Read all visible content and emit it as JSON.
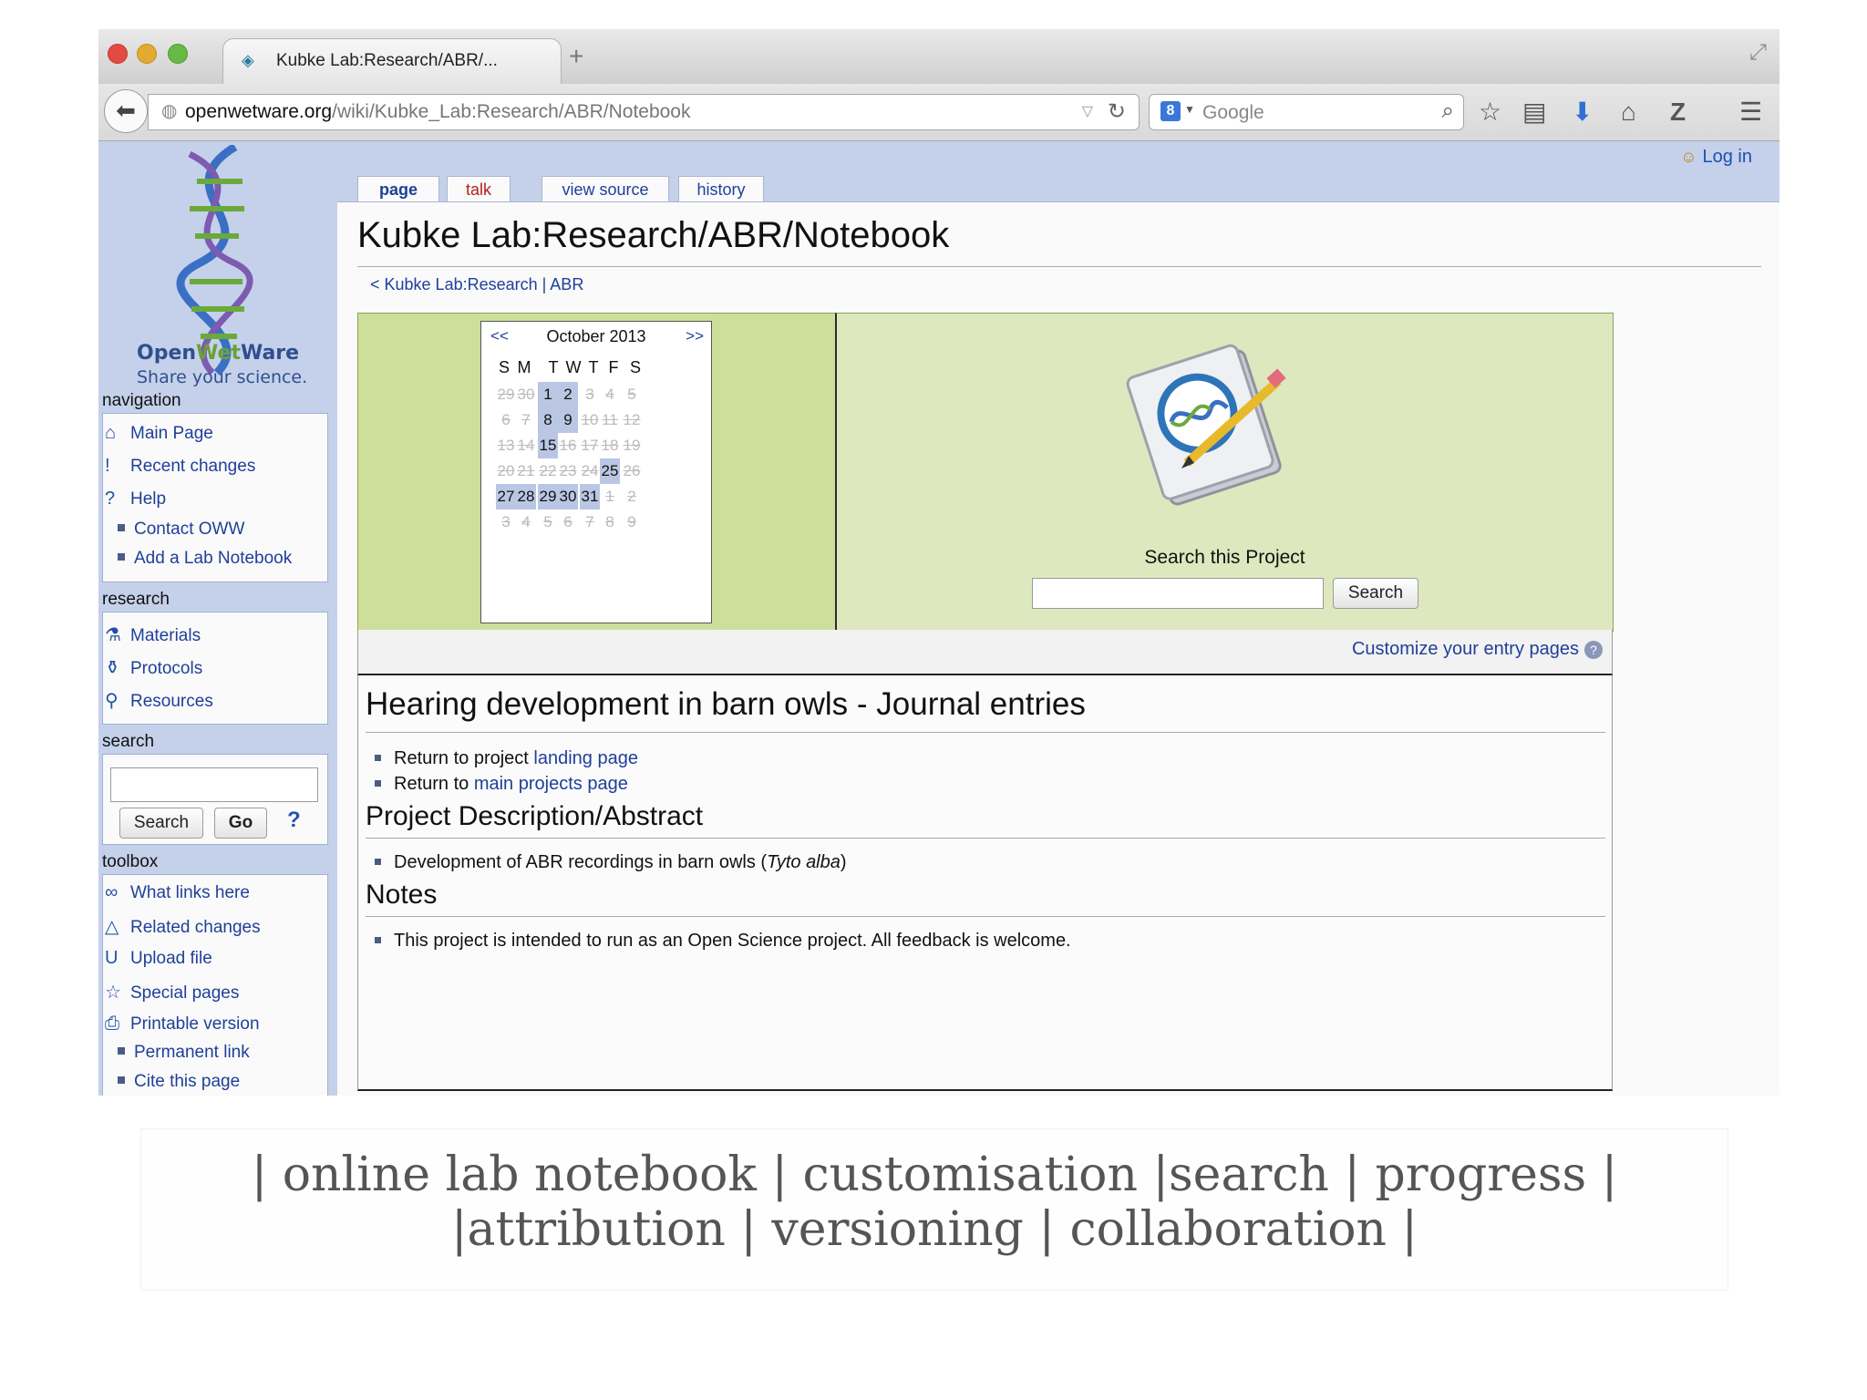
{
  "browser": {
    "tab_title": "Kubke Lab:Research/ABR/...",
    "new_tab": "+",
    "url_host": "openwetware.org",
    "url_path": "/wiki/Kubke_Lab:Research/ABR/Notebook",
    "search_engine": "Google",
    "search_icon_letter": "8"
  },
  "wiki": {
    "login": "Log in",
    "logo_name_part1": "Open",
    "logo_name_part2": "Wet",
    "logo_name_part3": "Ware",
    "logo_tagline": "Share your science.",
    "navigation": {
      "title": "navigation",
      "items": [
        "Main Page",
        "Recent changes",
        "Help",
        "Contact OWW",
        "Add a Lab Notebook"
      ]
    },
    "research": {
      "title": "research",
      "items": [
        "Materials",
        "Protocols",
        "Resources"
      ]
    },
    "search": {
      "title": "search",
      "search_btn": "Search",
      "go_btn": "Go",
      "help": "?"
    },
    "toolbox": {
      "title": "toolbox",
      "items": [
        "What links here",
        "Related changes",
        "Upload file",
        "Special pages",
        "Printable version",
        "Permanent link",
        "Cite this page"
      ]
    },
    "tabs": [
      "page",
      "talk",
      "view source",
      "history"
    ],
    "page_title": "Kubke Lab:Research/ABR/Notebook",
    "breadcrumb": "< Kubke Lab:Research | ABR",
    "calendar": {
      "prev": "<<",
      "next": ">>",
      "title": "October 2013",
      "dow": [
        "S",
        "M",
        "T",
        "W",
        "T",
        "F",
        "S"
      ],
      "weeks": [
        [
          "29",
          "30",
          "1",
          "2",
          "3",
          "4",
          "5"
        ],
        [
          "6",
          "7",
          "8",
          "9",
          "10",
          "11",
          "12"
        ],
        [
          "13",
          "14",
          "15",
          "16",
          "17",
          "18",
          "19"
        ],
        [
          "20",
          "21",
          "22",
          "23",
          "24",
          "25",
          "26"
        ],
        [
          "27",
          "28",
          "29",
          "30",
          "31",
          "1",
          "2"
        ],
        [
          "3",
          "4",
          "5",
          "6",
          "7",
          "8",
          "9"
        ]
      ],
      "entry_days": [
        "1",
        "2",
        "8",
        "9",
        "15",
        "25",
        "27",
        "28",
        "29",
        "30",
        "31"
      ]
    },
    "project_search_label": "Search this Project",
    "project_search_btn": "Search",
    "customize": "Customize your entry pages",
    "heading": "Hearing development in barn owls - Journal entries",
    "links": {
      "item1_prefix": "Return to project ",
      "item1_link": "landing page",
      "item2_prefix": "Return to ",
      "item2_link": "main projects page"
    },
    "abstract_heading": "Project Description/Abstract",
    "abstract_text": "Development of ABR recordings in barn owls (",
    "abstract_italic": "Tyto alba",
    "abstract_close": ")",
    "notes_heading": "Notes",
    "notes_text": "This project is intended to run as an Open Science project. All feedback is welcome."
  },
  "caption": {
    "line1": "| online lab notebook  | customisation  |search  | progress  |",
    "line2": "|attribution  |  versioning  |  collaboration  |"
  }
}
